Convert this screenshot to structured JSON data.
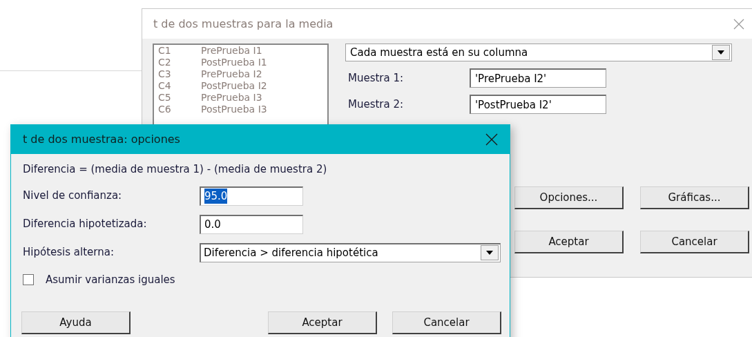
{
  "main_dialog": {
    "title": "t de dos muestras para la media",
    "columns": [
      {
        "id": "C1",
        "name": "PrePrueba I1"
      },
      {
        "id": "C2",
        "name": "PostPrueba I1"
      },
      {
        "id": "C3",
        "name": "PrePrueba I2"
      },
      {
        "id": "C4",
        "name": "PostPrueba I2"
      },
      {
        "id": "C5",
        "name": "PrePrueba I3"
      },
      {
        "id": "C6",
        "name": "PostPrueba I3"
      }
    ],
    "layout_select": "Cada muestra está en su columna",
    "fields": [
      {
        "label": "Muestra 1:",
        "value": "'PrePrueba I2'"
      },
      {
        "label": "Muestra 2:",
        "value": "'PostPrueba I2'"
      }
    ],
    "buttons": [
      "Opciones...",
      "Gráficas...",
      "Aceptar",
      "Cancelar"
    ]
  },
  "options_dialog": {
    "title": "t de dos muestraa: opciones",
    "formula": "Diferencia = (media de muestra 1) - (media de muestra 2)",
    "fields": [
      {
        "label": "Nivel de confianza:",
        "value": "95.0",
        "selected": true
      },
      {
        "label": "Diferencia hipotetizada:",
        "value": "0.0",
        "selected": false
      }
    ],
    "alternative": {
      "label": "Hipótesis alterna:",
      "value": "Diferencia > diferencia hipotética"
    },
    "equal_variances": {
      "label": "Asumir varianzas iguales",
      "checked": false
    },
    "buttons": [
      "Ayuda",
      "Aceptar",
      "Cancelar"
    ]
  }
}
